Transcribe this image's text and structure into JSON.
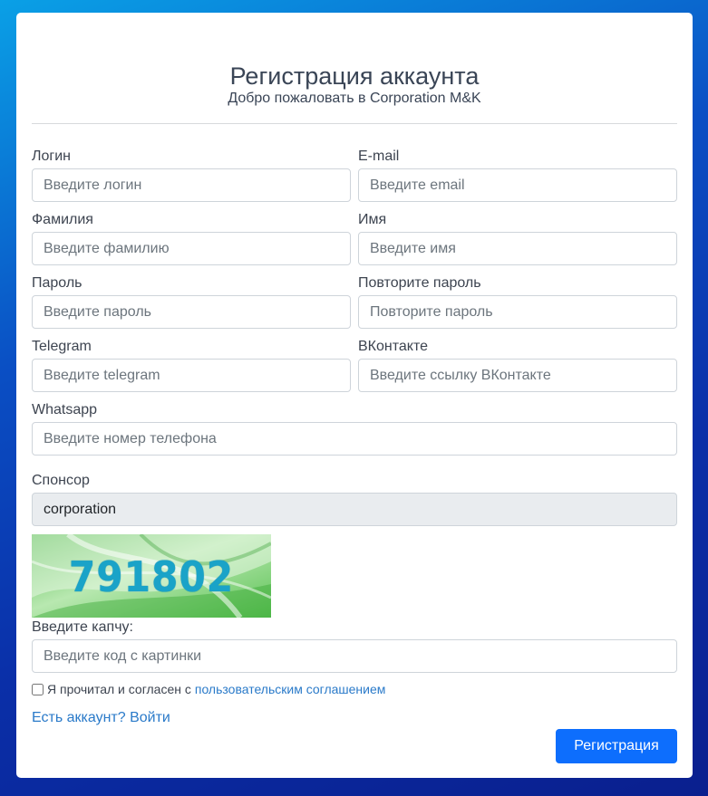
{
  "header": {
    "title": "Регистрация аккаунта",
    "subtitle": "Добро пожаловать в Corporation M&K"
  },
  "form": {
    "login": {
      "label": "Логин",
      "placeholder": "Введите логин",
      "value": ""
    },
    "email": {
      "label": "E-mail",
      "placeholder": "Введите email",
      "value": ""
    },
    "surname": {
      "label": "Фамилия",
      "placeholder": "Введите фамилию",
      "value": ""
    },
    "name": {
      "label": "Имя",
      "placeholder": "Введите имя",
      "value": ""
    },
    "password": {
      "label": "Пароль",
      "placeholder": "Введите пароль",
      "value": ""
    },
    "password_repeat": {
      "label": "Повторите пароль",
      "placeholder": "Повторите пароль",
      "value": ""
    },
    "telegram": {
      "label": "Telegram",
      "placeholder": "Введите telegram",
      "value": ""
    },
    "vk": {
      "label": "ВКонтакте",
      "placeholder": "Введите ссылку ВКонтакте",
      "value": ""
    },
    "whatsapp": {
      "label": "Whatsapp",
      "placeholder": "Введите номер телефона",
      "value": ""
    },
    "sponsor": {
      "label": "Спонсор",
      "value": "corporation"
    },
    "captcha": {
      "code": "791802",
      "label": "Введите капчу:",
      "placeholder": "Введите код с картинки",
      "value": ""
    },
    "agreement": {
      "text": "Я прочитал и согласен с",
      "link_text": "пользовательским соглашением",
      "checked": false
    },
    "login_link": "Есть аккаунт? Войти",
    "submit_label": "Регистрация"
  },
  "colors": {
    "accent": "#0d6efd",
    "link": "#2a7ac9",
    "captcha_text": "#1aa3c8",
    "captcha_bg": "#8fd68a"
  }
}
